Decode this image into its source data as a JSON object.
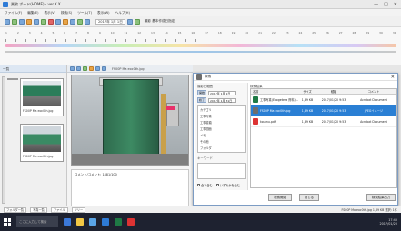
{
  "window": {
    "title": "業務 ボード(HOME) - ver.X.X",
    "buttons": [
      "—",
      "□",
      "✕"
    ]
  },
  "menu": [
    "ファイル(F)",
    "編集(E)",
    "表示(V)",
    "検索(S)",
    "ツール(T)",
    "表示(W)",
    "ヘルプ(H)"
  ],
  "toolbar": {
    "date": "2017年 1月 1日",
    "label": "撮影 基本作成日指定"
  },
  "timeline": {
    "ticks": [
      "1",
      "2",
      "3",
      "4",
      "5",
      "6",
      "7",
      "8",
      "9",
      "10",
      "11",
      "12",
      "13",
      "14",
      "15",
      "16",
      "17",
      "18",
      "19",
      "20",
      "21",
      "22",
      "23",
      "24",
      "25",
      "26",
      "27",
      "28",
      "29",
      "30",
      "31"
    ]
  },
  "sidebar": {
    "header": "一覧",
    "thumbnails": [
      {
        "caption": "FS00P Ma eoc0th.jpg"
      },
      {
        "caption": "FS00P Ma eoc0th.jpg"
      }
    ]
  },
  "viewer": {
    "title": "FS00P Ma eoc0th.jpg",
    "info_line": "コメント/コメント: 1881/100"
  },
  "dialog": {
    "title": "検索",
    "left": {
      "date_label": "撮影日範囲",
      "date_from": "2017年 1月 1日",
      "date_to": "2017年 1月 31日",
      "from_tag": "開始",
      "to_tag": "終了",
      "categories": [
        "カテゴリ",
        "工事写真",
        "工事書類",
        "工事図面",
        "メモ",
        "その他",
        "フォルダ"
      ],
      "keyword_label": "キーワード",
      "check1": "全て含む",
      "check2": "いずれかを含む"
    },
    "right": {
      "label": "検索結果",
      "columns": [
        "名前",
        "サイズ",
        "種類",
        "コメント"
      ],
      "rows": [
        {
          "name": "工事写真(Ecogetera 資料)...",
          "size": "1,89 KB",
          "date": "2017/01/20 9:53",
          "type": "Acrobat Document",
          "icon": "pdf",
          "selected": false
        },
        {
          "name": "FS00P Ma eoc0th.jpg",
          "size": "1,89 KB",
          "date": "2017/01/20 9:53",
          "type": "JPEGイメージ",
          "icon": "gen",
          "selected": true
        },
        {
          "name": "koumu.pdf",
          "size": "1,89 KB",
          "date": "2017/01/20 9:53",
          "type": "Acrobat Document",
          "icon": "pdf",
          "selected": false
        }
      ]
    },
    "buttons": {
      "search": "検索開始",
      "close": "閉じる",
      "settings": "検索結果出力"
    }
  },
  "statusbar": {
    "tabs": [
      "フォルダ一覧",
      "写真一覧",
      "ファイル",
      "ツリー"
    ],
    "right": "FS00P Ma eoc0th.jpg  1,89 KB   選択: 1件"
  },
  "taskbar": {
    "search": "ここに入力して検索",
    "time": "17:45",
    "date": "2017/01/20"
  }
}
